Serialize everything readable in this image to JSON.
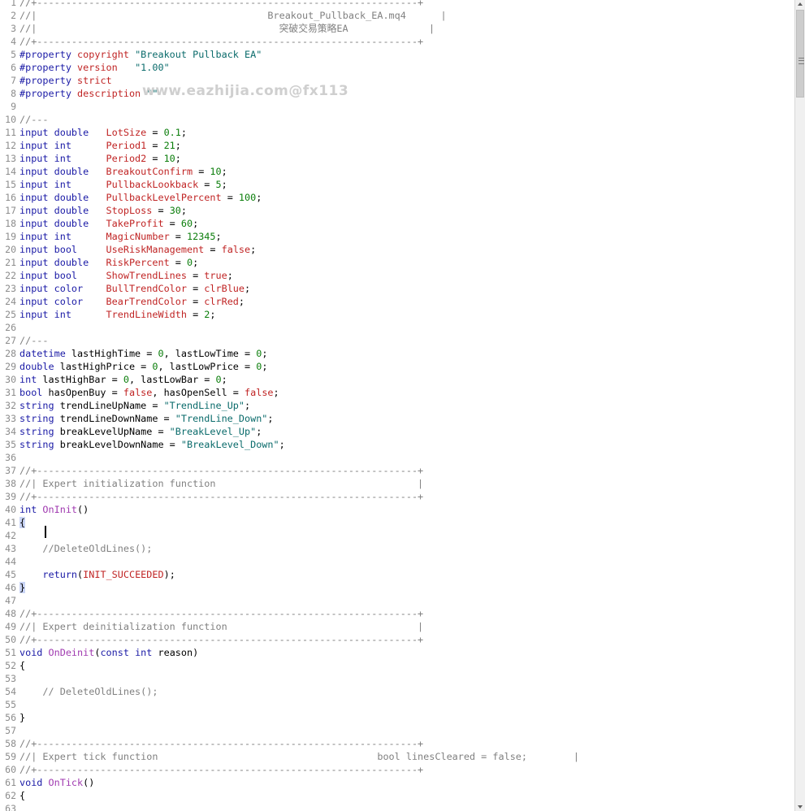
{
  "editor": {
    "watermark": "www.eazhijia.com@fx113",
    "lines": [
      {
        "n": "1",
        "t": [
          [
            "//+------------------------------------------------------------------+",
            "c"
          ]
        ]
      },
      {
        "n": "2",
        "t": [
          [
            "//|                                        Breakout_Pullback_EA.mq4      |",
            "c"
          ]
        ]
      },
      {
        "n": "3",
        "t": [
          [
            "//|                                          突破交易策略EA              |",
            "c"
          ]
        ]
      },
      {
        "n": "4",
        "t": [
          [
            "//+------------------------------------------------------------------+",
            "c"
          ]
        ]
      },
      {
        "n": "5",
        "t": [
          [
            "#property ",
            "k"
          ],
          [
            "copyright ",
            "v"
          ],
          [
            "\"Breakout Pullback EA\"",
            "s"
          ]
        ]
      },
      {
        "n": "6",
        "t": [
          [
            "#property ",
            "k"
          ],
          [
            "version   ",
            "v"
          ],
          [
            "\"1.00\"",
            "s"
          ]
        ]
      },
      {
        "n": "7",
        "t": [
          [
            "#property ",
            "k"
          ],
          [
            "strict",
            "v"
          ]
        ]
      },
      {
        "n": "8",
        "t": [
          [
            "#property ",
            "k"
          ],
          [
            "description ",
            "v"
          ],
          [
            "\"\"",
            "s"
          ]
        ]
      },
      {
        "n": "9",
        "t": []
      },
      {
        "n": "10",
        "t": [
          [
            "//---",
            "c"
          ]
        ]
      },
      {
        "n": "11",
        "t": [
          [
            "input double   ",
            "k"
          ],
          [
            "LotSize",
            "v"
          ],
          [
            " = ",
            ""
          ],
          [
            "0.1",
            "n"
          ],
          [
            ";",
            ""
          ]
        ]
      },
      {
        "n": "12",
        "t": [
          [
            "input int      ",
            "k"
          ],
          [
            "Period1",
            "v"
          ],
          [
            " = ",
            ""
          ],
          [
            "21",
            "n"
          ],
          [
            ";",
            ""
          ]
        ]
      },
      {
        "n": "13",
        "t": [
          [
            "input int      ",
            "k"
          ],
          [
            "Period2",
            "v"
          ],
          [
            " = ",
            ""
          ],
          [
            "10",
            "n"
          ],
          [
            ";",
            ""
          ]
        ]
      },
      {
        "n": "14",
        "t": [
          [
            "input double   ",
            "k"
          ],
          [
            "BreakoutConfirm",
            "v"
          ],
          [
            " = ",
            ""
          ],
          [
            "10",
            "n"
          ],
          [
            ";",
            ""
          ]
        ]
      },
      {
        "n": "15",
        "t": [
          [
            "input int      ",
            "k"
          ],
          [
            "PullbackLookback",
            "v"
          ],
          [
            " = ",
            ""
          ],
          [
            "5",
            "n"
          ],
          [
            ";",
            ""
          ]
        ]
      },
      {
        "n": "16",
        "t": [
          [
            "input double   ",
            "k"
          ],
          [
            "PullbackLevelPercent",
            "v"
          ],
          [
            " = ",
            ""
          ],
          [
            "100",
            "n"
          ],
          [
            ";",
            ""
          ]
        ]
      },
      {
        "n": "17",
        "t": [
          [
            "input double   ",
            "k"
          ],
          [
            "StopLoss",
            "v"
          ],
          [
            " = ",
            ""
          ],
          [
            "30",
            "n"
          ],
          [
            ";",
            ""
          ]
        ]
      },
      {
        "n": "18",
        "t": [
          [
            "input double   ",
            "k"
          ],
          [
            "TakeProfit",
            "v"
          ],
          [
            " = ",
            ""
          ],
          [
            "60",
            "n"
          ],
          [
            ";",
            ""
          ]
        ]
      },
      {
        "n": "19",
        "t": [
          [
            "input int      ",
            "k"
          ],
          [
            "MagicNumber",
            "v"
          ],
          [
            " = ",
            ""
          ],
          [
            "12345",
            "n"
          ],
          [
            ";",
            ""
          ]
        ]
      },
      {
        "n": "20",
        "t": [
          [
            "input bool     ",
            "k"
          ],
          [
            "UseRiskManagement",
            "v"
          ],
          [
            " = ",
            ""
          ],
          [
            "false",
            "v"
          ],
          [
            ";",
            ""
          ]
        ]
      },
      {
        "n": "21",
        "t": [
          [
            "input double   ",
            "k"
          ],
          [
            "RiskPercent",
            "v"
          ],
          [
            " = ",
            ""
          ],
          [
            "0",
            "n"
          ],
          [
            ";",
            ""
          ]
        ]
      },
      {
        "n": "22",
        "t": [
          [
            "input bool     ",
            "k"
          ],
          [
            "ShowTrendLines",
            "v"
          ],
          [
            " = ",
            ""
          ],
          [
            "true",
            "v"
          ],
          [
            ";",
            ""
          ]
        ]
      },
      {
        "n": "23",
        "t": [
          [
            "input color    ",
            "k"
          ],
          [
            "BullTrendColor",
            "v"
          ],
          [
            " = ",
            ""
          ],
          [
            "clrBlue",
            "v"
          ],
          [
            ";",
            ""
          ]
        ]
      },
      {
        "n": "24",
        "t": [
          [
            "input color    ",
            "k"
          ],
          [
            "BearTrendColor",
            "v"
          ],
          [
            " = ",
            ""
          ],
          [
            "clrRed",
            "v"
          ],
          [
            ";",
            ""
          ]
        ]
      },
      {
        "n": "25",
        "t": [
          [
            "input int      ",
            "k"
          ],
          [
            "TrendLineWidth",
            "v"
          ],
          [
            " = ",
            ""
          ],
          [
            "2",
            "n"
          ],
          [
            ";",
            ""
          ]
        ]
      },
      {
        "n": "26",
        "t": []
      },
      {
        "n": "27",
        "t": [
          [
            "//---",
            "c"
          ]
        ]
      },
      {
        "n": "28",
        "t": [
          [
            "datetime ",
            "k"
          ],
          [
            "lastHighTime = ",
            ""
          ],
          [
            "0",
            "n"
          ],
          [
            ", lastLowTime = ",
            ""
          ],
          [
            "0",
            "n"
          ],
          [
            ";",
            ""
          ]
        ]
      },
      {
        "n": "29",
        "t": [
          [
            "double ",
            "k"
          ],
          [
            "lastHighPrice = ",
            ""
          ],
          [
            "0",
            "n"
          ],
          [
            ", lastLowPrice = ",
            ""
          ],
          [
            "0",
            "n"
          ],
          [
            ";",
            ""
          ]
        ]
      },
      {
        "n": "30",
        "t": [
          [
            "int ",
            "k"
          ],
          [
            "lastHighBar = ",
            ""
          ],
          [
            "0",
            "n"
          ],
          [
            ", lastLowBar = ",
            ""
          ],
          [
            "0",
            "n"
          ],
          [
            ";",
            ""
          ]
        ]
      },
      {
        "n": "31",
        "t": [
          [
            "bool ",
            "k"
          ],
          [
            "hasOpenBuy = ",
            ""
          ],
          [
            "false",
            "v"
          ],
          [
            ", hasOpenSell = ",
            ""
          ],
          [
            "false",
            "v"
          ],
          [
            ";",
            ""
          ]
        ]
      },
      {
        "n": "32",
        "t": [
          [
            "string ",
            "k"
          ],
          [
            "trendLineUpName = ",
            ""
          ],
          [
            "\"TrendLine_Up\"",
            "s"
          ],
          [
            ";",
            ""
          ]
        ]
      },
      {
        "n": "33",
        "t": [
          [
            "string ",
            "k"
          ],
          [
            "trendLineDownName = ",
            ""
          ],
          [
            "\"TrendLine_Down\"",
            "s"
          ],
          [
            ";",
            ""
          ]
        ]
      },
      {
        "n": "34",
        "t": [
          [
            "string ",
            "k"
          ],
          [
            "breakLevelUpName = ",
            ""
          ],
          [
            "\"BreakLevel_Up\"",
            "s"
          ],
          [
            ";",
            ""
          ]
        ]
      },
      {
        "n": "35",
        "t": [
          [
            "string ",
            "k"
          ],
          [
            "breakLevelDownName = ",
            ""
          ],
          [
            "\"BreakLevel_Down\"",
            "s"
          ],
          [
            ";",
            ""
          ]
        ]
      },
      {
        "n": "36",
        "t": []
      },
      {
        "n": "37",
        "t": [
          [
            "//+------------------------------------------------------------------+",
            "c"
          ]
        ]
      },
      {
        "n": "38",
        "t": [
          [
            "//| Expert initialization function                                   |",
            "c"
          ]
        ]
      },
      {
        "n": "39",
        "t": [
          [
            "//+------------------------------------------------------------------+",
            "c"
          ]
        ]
      },
      {
        "n": "40",
        "t": [
          [
            "int ",
            "k"
          ],
          [
            "OnInit",
            "f"
          ],
          [
            "()",
            ""
          ]
        ]
      },
      {
        "n": "41",
        "t": [
          [
            "{",
            "b"
          ]
        ]
      },
      {
        "n": "42",
        "t": []
      },
      {
        "n": "43",
        "t": [
          [
            "    //DeleteOldLines();",
            "c"
          ]
        ]
      },
      {
        "n": "44",
        "t": []
      },
      {
        "n": "45",
        "t": [
          [
            "    ",
            ""
          ],
          [
            "return",
            "k"
          ],
          [
            "(",
            ""
          ],
          [
            "INIT_SUCCEEDED",
            "v"
          ],
          [
            ");",
            ""
          ]
        ]
      },
      {
        "n": "46",
        "t": [
          [
            "}",
            "b"
          ]
        ]
      },
      {
        "n": "47",
        "t": []
      },
      {
        "n": "48",
        "t": [
          [
            "//+------------------------------------------------------------------+",
            "c"
          ]
        ]
      },
      {
        "n": "49",
        "t": [
          [
            "//| Expert deinitialization function                                 |",
            "c"
          ]
        ]
      },
      {
        "n": "50",
        "t": [
          [
            "//+------------------------------------------------------------------+",
            "c"
          ]
        ]
      },
      {
        "n": "51",
        "t": [
          [
            "void ",
            "k"
          ],
          [
            "OnDeinit",
            "f"
          ],
          [
            "(",
            ""
          ],
          [
            "const int ",
            "k"
          ],
          [
            "reason)",
            ""
          ]
        ]
      },
      {
        "n": "52",
        "t": [
          [
            "{",
            ""
          ]
        ]
      },
      {
        "n": "53",
        "t": []
      },
      {
        "n": "54",
        "t": [
          [
            "    // DeleteOldLines();",
            "c"
          ]
        ]
      },
      {
        "n": "55",
        "t": []
      },
      {
        "n": "56",
        "t": [
          [
            "}",
            ""
          ]
        ]
      },
      {
        "n": "57",
        "t": []
      },
      {
        "n": "58",
        "t": [
          [
            "//+------------------------------------------------------------------+",
            "c"
          ]
        ]
      },
      {
        "n": "59",
        "t": [
          [
            "//| Expert tick function                                      bool linesCleared = false;        |",
            "c"
          ]
        ]
      },
      {
        "n": "60",
        "t": [
          [
            "//+------------------------------------------------------------------+",
            "c"
          ]
        ]
      },
      {
        "n": "61",
        "t": [
          [
            "void ",
            "k"
          ],
          [
            "OnTick",
            "f"
          ],
          [
            "()",
            ""
          ]
        ]
      },
      {
        "n": "62",
        "t": [
          [
            "{",
            ""
          ]
        ]
      },
      {
        "n": "63",
        "t": []
      }
    ]
  }
}
